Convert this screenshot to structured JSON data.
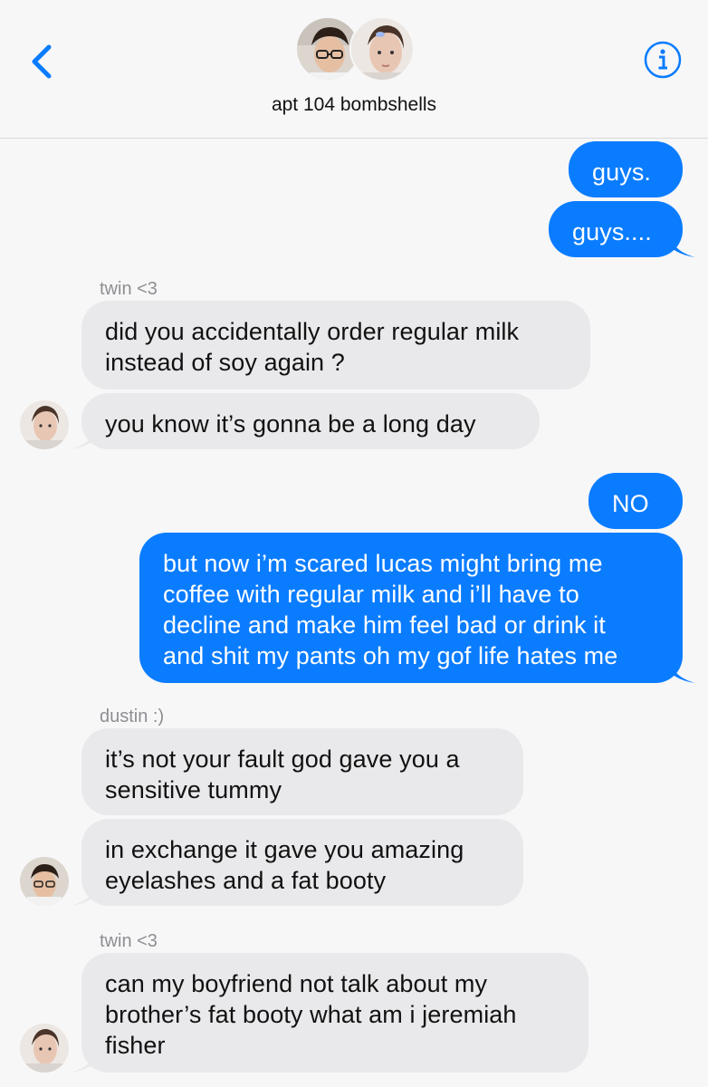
{
  "header": {
    "title": "apt 104 bombshells",
    "back_icon": "chevron-left-icon",
    "info_icon": "info-icon",
    "accent_color": "#0a7cff"
  },
  "messages": [
    {
      "direction": "outgoing",
      "text": "guys."
    },
    {
      "direction": "outgoing",
      "text": "guys...."
    },
    {
      "direction": "incoming",
      "sender": "twin <3",
      "text": "did you accidentally order regular milk\ninstead of soy again ?"
    },
    {
      "direction": "incoming",
      "text": "you know it’s gonna be a long day"
    },
    {
      "direction": "outgoing",
      "text": "NO"
    },
    {
      "direction": "outgoing",
      "text": "but now i’m scared lucas might bring me\ncoffee with regular milk and i’ll have to\ndecline and make him feel bad or drink it\nand shit my pants oh my gof life hates me"
    },
    {
      "direction": "incoming",
      "sender": "dustin :)",
      "text": "it’s not your fault god gave you a\nsensitive tummy"
    },
    {
      "direction": "incoming",
      "text": "in exchange it gave you amazing\neyelashes and a fat booty"
    },
    {
      "direction": "incoming",
      "sender": "twin <3",
      "text": "can my boyfriend not talk about my\nbrother’s fat booty what am i jeremiah\nfisher"
    }
  ],
  "colors": {
    "outgoing_bubble": "#0a7cff",
    "incoming_bubble": "#e9e9eb",
    "sender_label": "#8e8e93"
  }
}
